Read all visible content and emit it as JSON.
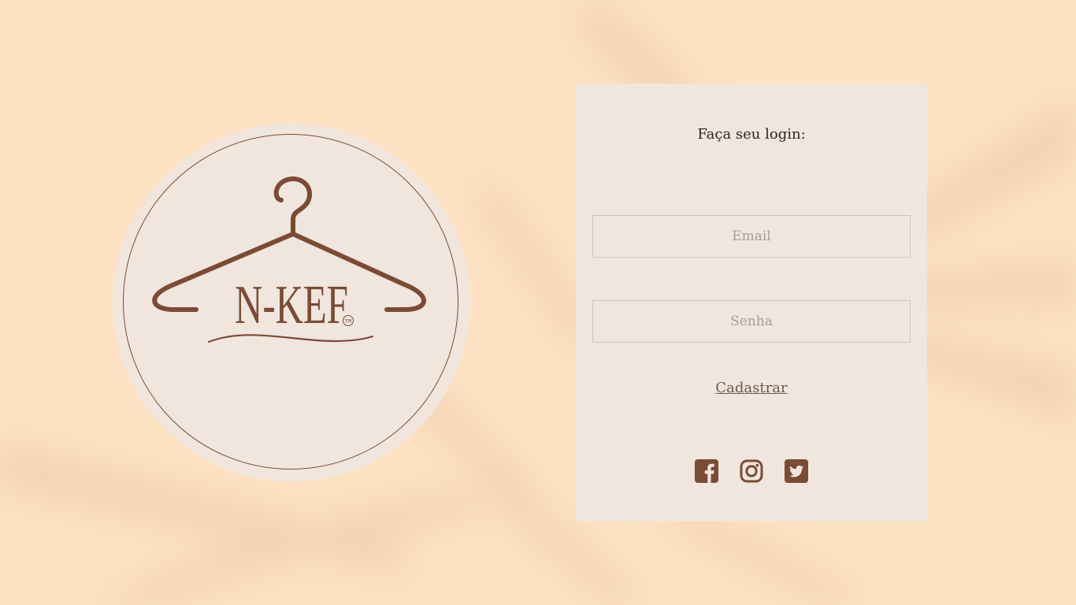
{
  "brand": {
    "name": "N-KEF",
    "trademark": "TM"
  },
  "login": {
    "title": "Faça seu login:",
    "email_placeholder": "Email",
    "password_placeholder": "Senha",
    "register_label": "Cadastrar"
  },
  "social": [
    {
      "icon": "facebook-icon"
    },
    {
      "icon": "instagram-icon"
    },
    {
      "icon": "twitter-icon"
    }
  ],
  "colors": {
    "background": "#fde1c3",
    "panel": "#f0e6de",
    "brand_brown": "#7a4b35",
    "text_dark": "#2f2520",
    "placeholder": "#a99d94"
  }
}
